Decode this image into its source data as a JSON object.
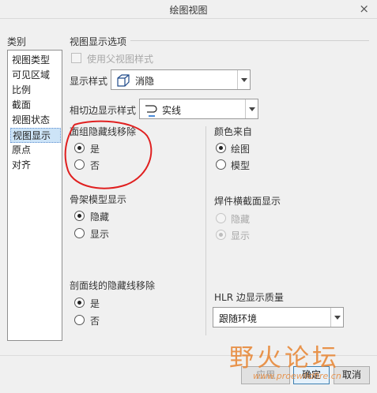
{
  "window": {
    "title": "绘图视图",
    "close_glyph": "×"
  },
  "categories": {
    "header": "类别",
    "items": [
      "视图类型",
      "可见区域",
      "比例",
      "截面",
      "视图状态",
      "视图显示",
      "原点",
      "对齐"
    ],
    "selected_index": 5
  },
  "view_display": {
    "section_title": "视图显示选项",
    "use_parent_style_label": "使用父视图样式",
    "display_style_label": "显示样式",
    "display_style_value": "消隐",
    "tangent_style_label": "相切边显示样式",
    "tangent_style_value": "实线"
  },
  "hidden_line_removal": {
    "title": "面组隐藏线移除",
    "options": [
      "是",
      "否"
    ],
    "selected": "是"
  },
  "color_from": {
    "title": "颜色来自",
    "options": [
      "绘图",
      "模型"
    ],
    "selected": "绘图"
  },
  "skeleton_display": {
    "title": "骨架模型显示",
    "options": [
      "隐藏",
      "显示"
    ],
    "selected": "隐藏"
  },
  "weld_section_display": {
    "title": "焊件横截面显示",
    "options": [
      "隐藏",
      "显示"
    ],
    "selected": "显示"
  },
  "section_hidden_line": {
    "title": "剖面线的隐藏线移除",
    "options": [
      "是",
      "否"
    ],
    "selected": "是"
  },
  "hlr_quality": {
    "title": "HLR 边显示质量",
    "value": "跟随环境"
  },
  "buttons": {
    "apply": "应用",
    "ok": "确定",
    "cancel": "取消"
  },
  "watermark": {
    "text": "野火论坛",
    "url": "www.proewildfire.cn"
  },
  "colors": {
    "annotation_circle": "#e02020",
    "selection": "#cde4f7",
    "watermark": "#e8893a"
  }
}
